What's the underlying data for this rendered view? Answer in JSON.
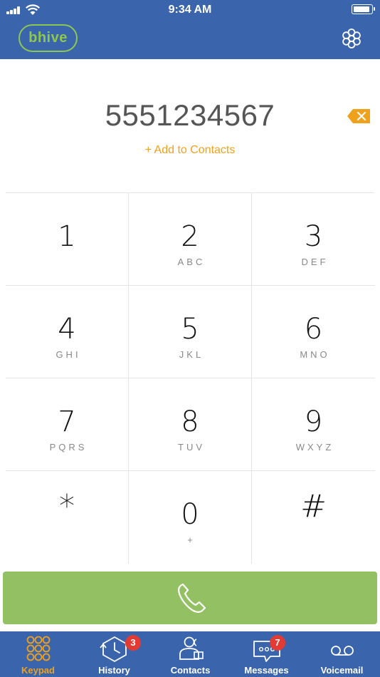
{
  "status_bar": {
    "time": "9:34 AM"
  },
  "header": {
    "logo": "bhive",
    "settings_icon": "flower-gear-icon"
  },
  "dialer": {
    "number": "5551234567",
    "add_to_contacts": "+ Add to Contacts"
  },
  "keys": [
    {
      "digit": "1",
      "letters": ""
    },
    {
      "digit": "2",
      "letters": "ABC"
    },
    {
      "digit": "3",
      "letters": "DEF"
    },
    {
      "digit": "4",
      "letters": "GHI"
    },
    {
      "digit": "5",
      "letters": "JKL"
    },
    {
      "digit": "6",
      "letters": "MNO"
    },
    {
      "digit": "7",
      "letters": "PQRS"
    },
    {
      "digit": "8",
      "letters": "TUV"
    },
    {
      "digit": "9",
      "letters": "WXYZ"
    },
    {
      "digit": "*",
      "letters": ""
    },
    {
      "digit": "0",
      "letters": "+"
    },
    {
      "digit": "#",
      "letters": ""
    }
  ],
  "tabs": [
    {
      "label": "Keypad",
      "icon": "keypad-icon",
      "active": true
    },
    {
      "label": "History",
      "icon": "history-icon",
      "badge": "3"
    },
    {
      "label": "Contacts",
      "icon": "contacts-icon"
    },
    {
      "label": "Messages",
      "icon": "messages-icon",
      "badge": "7"
    },
    {
      "label": "Voicemail",
      "icon": "voicemail-icon"
    }
  ],
  "colors": {
    "header_blue": "#3a65ad",
    "accent_orange": "#f0a11c",
    "call_green": "#93c063",
    "logo_green": "#8dc74f",
    "badge_red": "#e23b33"
  }
}
